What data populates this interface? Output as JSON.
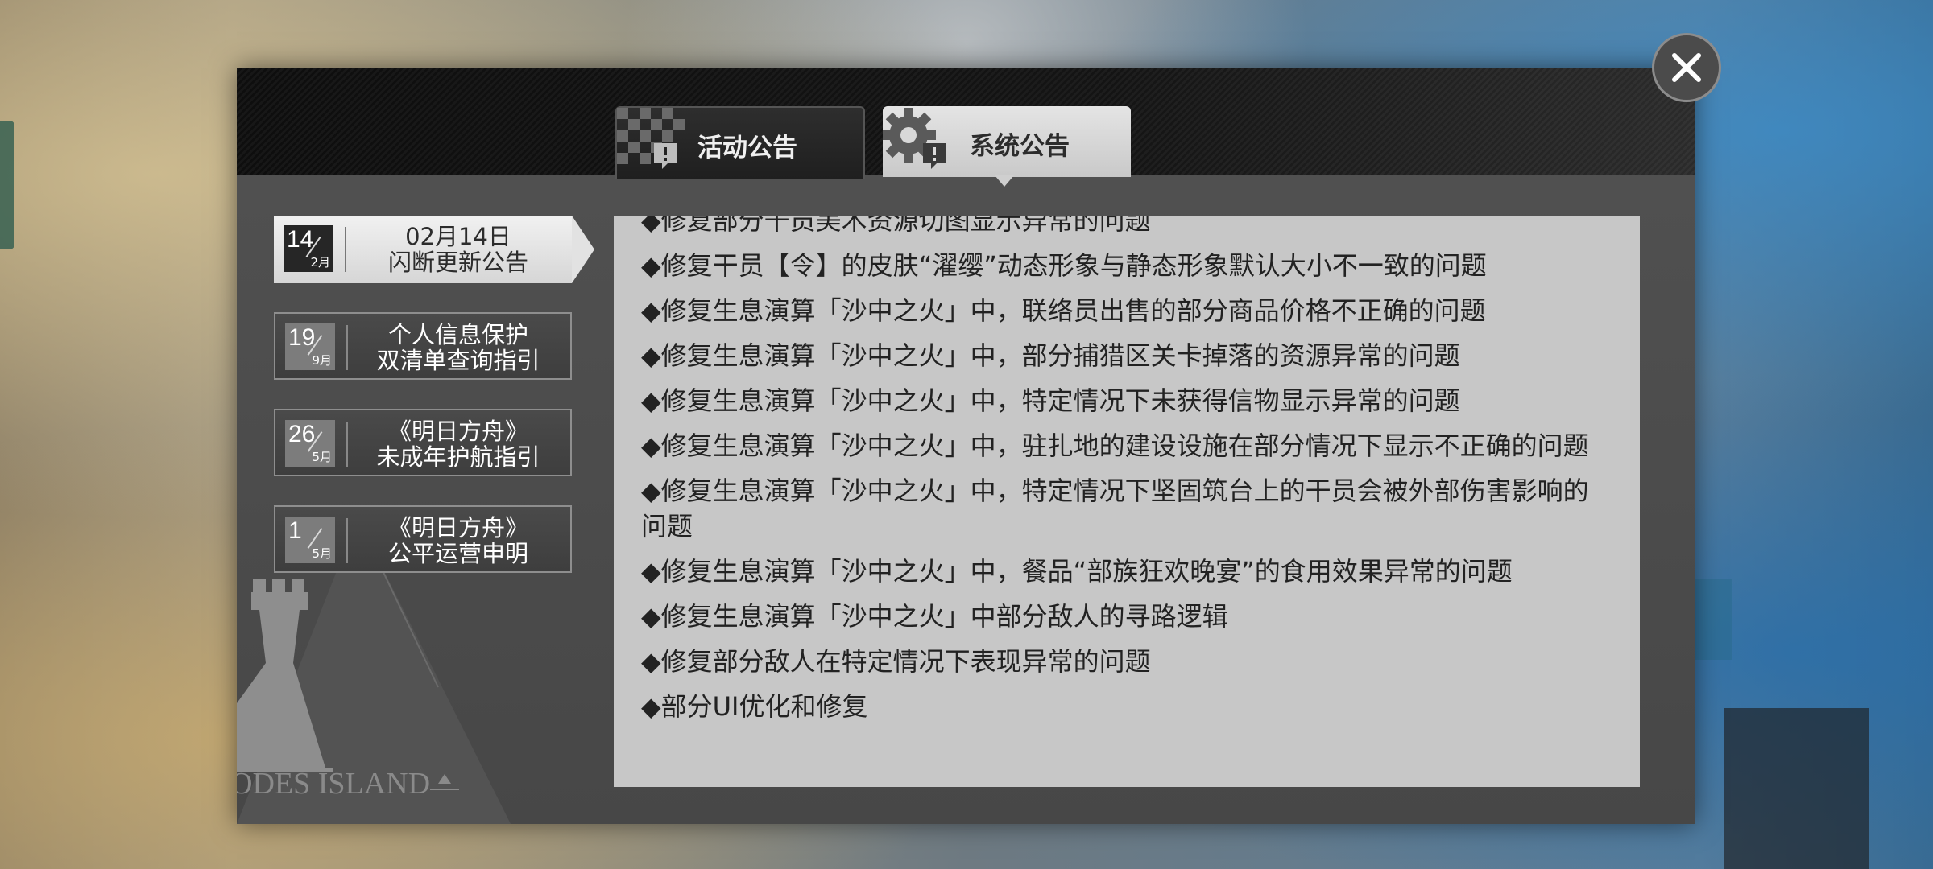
{
  "tabs": [
    {
      "label": "活动公告",
      "icon": "checker-flag-warning-icon",
      "active": false
    },
    {
      "label": "系统公告",
      "icon": "gear-warning-icon",
      "active": true
    }
  ],
  "sidebar": {
    "items": [
      {
        "day": "14",
        "month": "2月",
        "title_line1": "02月14日",
        "title_line2": "闪断更新公告",
        "active": true
      },
      {
        "day": "19",
        "month": "9月",
        "title_line1": "个人信息保护",
        "title_line2": "双清单查询指引",
        "active": false
      },
      {
        "day": "26",
        "month": "5月",
        "title_line1": "《明日方舟》",
        "title_line2": "未成年护航指引",
        "active": false
      },
      {
        "day": "1",
        "month": "5月",
        "title_line1": "《明日方舟》",
        "title_line2": "公平运营申明",
        "active": false
      }
    ]
  },
  "emblem": {
    "text": "RHODES ISLAND",
    "visible_text": "ODES ISLAND",
    "icon": "rhodes-island-tower-logo"
  },
  "content": {
    "lines": [
      "◆修复部分干员美术资源切图显示异常的问题",
      "◆修复干员【令】的皮肤“濯缨”动态形象与静态形象默认大小不一致的问题",
      "◆修复生息演算「沙中之火」中，联络员出售的部分商品价格不正确的问题",
      "◆修复生息演算「沙中之火」中，部分捕猎区关卡掉落的资源异常的问题",
      "◆修复生息演算「沙中之火」中，特定情况下未获得信物显示异常的问题",
      "◆修复生息演算「沙中之火」中，驻扎地的建设设施在部分情况下显示不正确的问题",
      "◆修复生息演算「沙中之火」中，特定情况下坚固筑台上的干员会被外部伤害影响的问题",
      "◆修复生息演算「沙中之火」中，餐品“部族狂欢晚宴”的食用效果异常的问题",
      "◆修复生息演算「沙中之火」中部分敌人的寻路逻辑",
      "◆修复部分敌人在特定情况下表现异常的问题",
      "◆部分UI优化和修复"
    ]
  },
  "close_button": {
    "icon": "close-icon"
  }
}
